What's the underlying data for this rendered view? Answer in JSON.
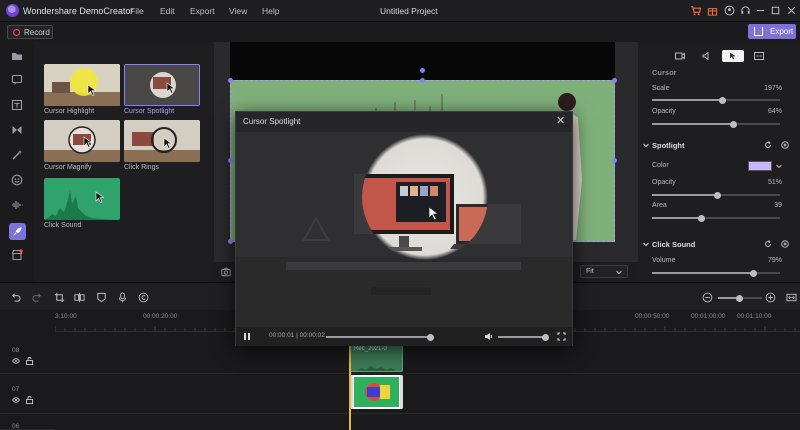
{
  "app": {
    "name": "Wondershare DemoCreator",
    "project_title": "Untitled Project",
    "menu": [
      "File",
      "Edit",
      "Export",
      "View",
      "Help"
    ]
  },
  "toolbar": {
    "record_label": "Record",
    "export_label": "Export"
  },
  "effects": [
    {
      "label": "Cursor Highlight",
      "selected": false
    },
    {
      "label": "Cursor Spotlight",
      "selected": true
    },
    {
      "label": "Cursor Magnify",
      "selected": false
    },
    {
      "label": "Click Rings",
      "selected": false
    },
    {
      "label": "Click Sound",
      "selected": false
    }
  ],
  "preview": {
    "fit_label": "Fit"
  },
  "properties": {
    "cursor_section": "Cursor",
    "scale_label": "Scale",
    "scale_value": "197%",
    "scale_fraction": 0.55,
    "opacity_label": "Opacity",
    "opacity_value": "64%",
    "opacity_fraction": 0.64,
    "spotlight_section": "Spotlight",
    "color_label": "Color",
    "spot_color": "#c9b8ff",
    "spot_opacity_label": "Opacity",
    "spot_opacity_value": "51%",
    "spot_opacity_fraction": 0.51,
    "area_label": "Area",
    "area_value": "39",
    "area_fraction": 0.39,
    "clicksound_section": "Click Sound",
    "volume_label": "Volume",
    "volume_value": "79%",
    "volume_fraction": 0.79
  },
  "timeline": {
    "ruler_labels": [
      "3:10:00",
      "00:00:20:00",
      "00:00:50:00",
      "00:01:00:00",
      "00:01:10:00"
    ],
    "tracks": [
      "08",
      "07",
      "06"
    ],
    "clip_label": "Rec_2021-0"
  },
  "dialog": {
    "title": "Cursor Spotlight",
    "time": "00:00:01 | 00:00:02"
  },
  "colors": {
    "accent": "#7c72d9",
    "playhead": "#e6b53a",
    "canvas_green": "#7fb07a"
  }
}
